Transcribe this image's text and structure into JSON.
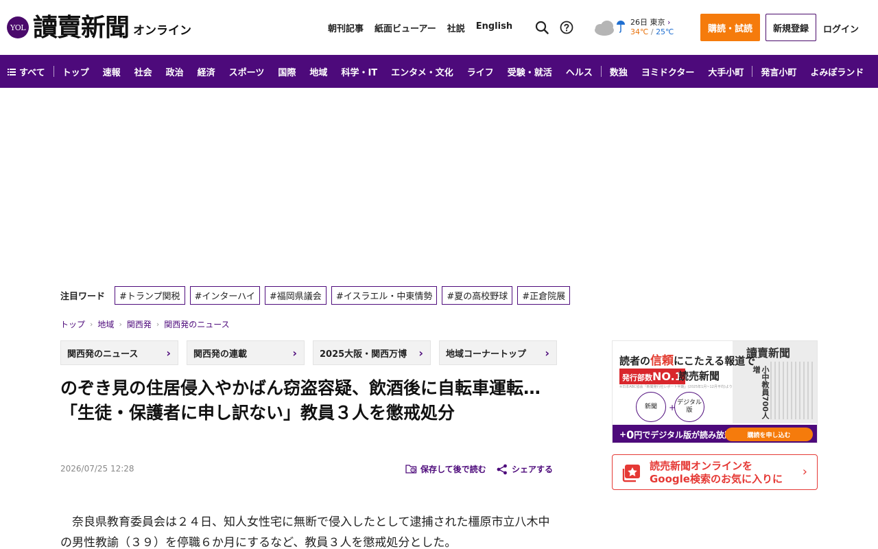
{
  "header": {
    "logo_badge": "YOL",
    "logo_text": "讀賣新聞",
    "logo_sub": "オンライン",
    "nav": [
      "朝刊記事",
      "紙面ビューアー",
      "社説",
      "English"
    ],
    "weather": {
      "date": "26日",
      "city": "東京",
      "high": "34℃",
      "low": "25℃",
      "high_color": "#e8720c",
      "low_color": "#1f6fd1",
      "icon": "cloud-rain-icon"
    },
    "subscribe_label": "購読・試読",
    "register_label": "新規登録",
    "login_label": "ログイン",
    "accent_color": "#f57b0c"
  },
  "mainnav": {
    "menu_label": "すべて",
    "items_a": [
      "トップ",
      "速報",
      "社会",
      "政治",
      "経済",
      "スポーツ",
      "国際",
      "地域",
      "科学・IT",
      "エンタメ・文化",
      "ライフ",
      "受験・就活",
      "ヘルス"
    ],
    "items_b": [
      "数独",
      "ヨミドクター",
      "大手小町"
    ],
    "items_c": [
      "発言小町",
      "よみぽランド"
    ],
    "bg_color": "#4d0a7b"
  },
  "trend": {
    "label": "注目ワード",
    "tags": [
      "#トランプ関税",
      "#インターハイ",
      "#福岡県議会",
      "#イスラエル・中東情勢",
      "#夏の高校野球",
      "#正倉院展"
    ]
  },
  "breadcrumb": [
    "トップ",
    "地域",
    "関西発",
    "関西発のニュース"
  ],
  "categories": [
    "関西発のニュース",
    "関西発の連載",
    "2025大阪・関西万博",
    "地域コーナートップ"
  ],
  "article": {
    "title": "のぞき見の住居侵入やかばん窃盗容疑、飲酒後に自転車運転…「生徒・保護者に申し訳ない」教員３人を懲戒処分",
    "date": "2026/07/25 12:28",
    "save_label": "保存して後で読む",
    "share_label": "シェアする",
    "body": "　奈良県教育委員会は２４日、知人女性宅に無断で侵入したとして逮捕された橿原市立八木中の男性教諭（３９）を停職６か月にするなど、教員３人を懲戒処分とした。"
  },
  "ad1": {
    "head_a": "読者の",
    "head_b": "信頼",
    "head_c": "にこたえる報道で",
    "badge_a": "発行部数",
    "badge_b": "NO.1",
    "paper_name": "読売新聞",
    "fine": "※日本ABC協会「新聞発行社レポート半期」(2025年1月~12月平均)より",
    "circle_a": "新聞",
    "circle_b": "デジタル版",
    "newspaper_title": "讀賣新聞",
    "newspaper_headline": "小中教員700人増",
    "bottom_a": "+",
    "bottom_b": "0",
    "bottom_c": "円でデジタル版が読み放題！",
    "cta": "購読を申し込む"
  },
  "ad2": {
    "line1": "読売新聞オンラインを",
    "line2": "Google検索のお気に入りに"
  }
}
